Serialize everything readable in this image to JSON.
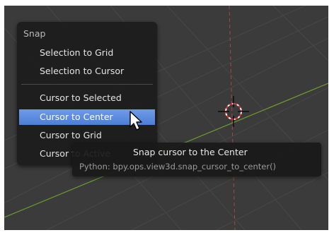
{
  "menu": {
    "title": "Snap",
    "items": [
      {
        "label": "Selection to Grid"
      },
      {
        "label": "Selection to Cursor"
      },
      {
        "label": "Cursor to Selected"
      },
      {
        "label": "Cursor to Center"
      },
      {
        "label": "Cursor to Grid"
      },
      {
        "label": "Cursor to Active"
      }
    ],
    "active_index": 3
  },
  "tooltip": {
    "title": "Snap cursor to the Center",
    "python": "Python: bpy.ops.view3d.snap_cursor_to_center()"
  },
  "colors": {
    "viewport_bg": "#3b3b3b",
    "grid": "#464646",
    "x_axis": "#7aa832",
    "y_axis": "#a44848",
    "highlight": "#5a8ee0"
  },
  "icons": {
    "pointer": "mouse-pointer-icon",
    "cursor3d": "3d-cursor-icon"
  }
}
